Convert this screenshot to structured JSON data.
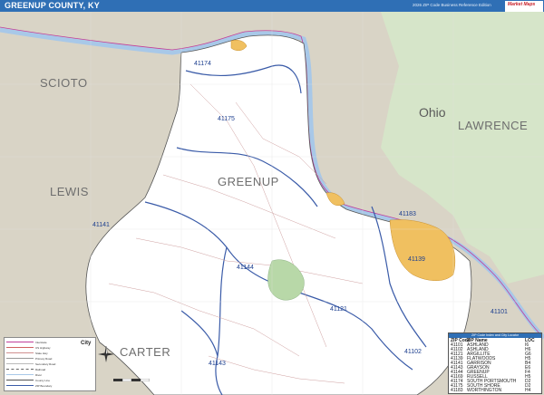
{
  "header": {
    "title": "GREENUP COUNTY, KY",
    "edition": "2026 ZIP Code Business Reference Edition",
    "brand": "Market Maps"
  },
  "map_labels": {
    "counties": {
      "scioto": "SCIOTO",
      "lawrence": "LAWRENCE",
      "lewis": "LEWIS",
      "greenup": "GREENUP",
      "carter": "CARTER"
    },
    "state": "Ohio",
    "zips": {
      "z41174": "41174",
      "z41175": "41175",
      "z41141": "41141",
      "z41144": "41144",
      "z41183": "41183",
      "z41139": "41139",
      "z41121": "41121",
      "z41143": "41143",
      "z41102": "41102",
      "z41101": "41101"
    }
  },
  "legend": {
    "city_label": "City",
    "rows": [
      "Interstate",
      "US Highway",
      "State Hwy",
      "Primary Road",
      "Secondary Road",
      "Railroad",
      "River",
      "County Line",
      "ZIP Boundary"
    ]
  },
  "zip_table": {
    "heading": "ZIP Code Index and City Locator",
    "columns": {
      "zip": "ZIP Code",
      "name": "ZIP Name",
      "loc": "LOC"
    },
    "rows": [
      {
        "zip": "41101",
        "name": "ASHLAND",
        "loc": "I6"
      },
      {
        "zip": "41102",
        "name": "ASHLAND",
        "loc": "H6"
      },
      {
        "zip": "41121",
        "name": "ARGILLITE",
        "loc": "G6"
      },
      {
        "zip": "41139",
        "name": "FLATWOODS",
        "loc": "H5"
      },
      {
        "zip": "41141",
        "name": "GARRISON",
        "loc": "B4"
      },
      {
        "zip": "41143",
        "name": "GRAYSON",
        "loc": "E6"
      },
      {
        "zip": "41144",
        "name": "GREENUP",
        "loc": "F4"
      },
      {
        "zip": "41169",
        "name": "RUSSELL",
        "loc": "H5"
      },
      {
        "zip": "41174",
        "name": "SOUTH PORTSMOUTH",
        "loc": "D2"
      },
      {
        "zip": "41175",
        "name": "SOUTH SHORE",
        "loc": "D2"
      },
      {
        "zip": "41183",
        "name": "WORTHINGTON",
        "loc": "H4"
      }
    ]
  },
  "colors": {
    "title_bar": "#2f6fb5",
    "outside_land": "#d9d4c6",
    "ohio_green": "#d6e5c9",
    "county_fill": "#ffffff",
    "river": "#a8c8e8",
    "urban": "#f0c060",
    "zip_boundary": "#3a5ba8",
    "river_outline": "#c03d9a"
  }
}
